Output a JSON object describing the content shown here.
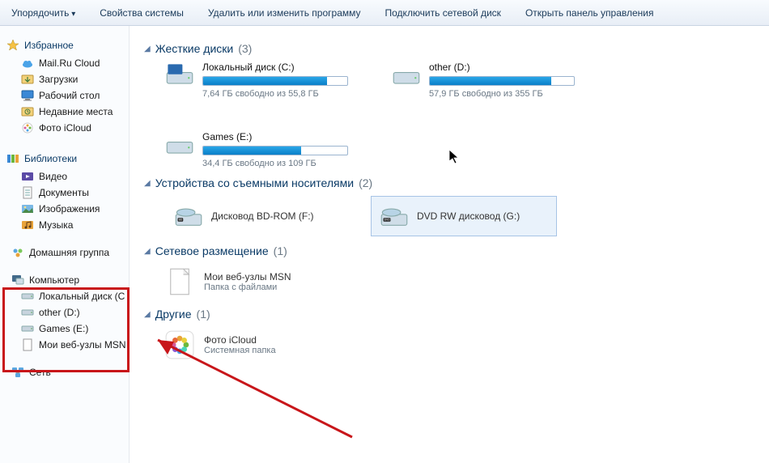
{
  "toolbar": {
    "organize": "Упорядочить",
    "system_props": "Свойства системы",
    "uninstall": "Удалить или изменить программу",
    "map_drive": "Подключить сетевой диск",
    "control_panel": "Открыть панель управления"
  },
  "sidebar": {
    "favorites": {
      "title": "Избранное",
      "items": [
        "Mail.Ru Cloud",
        "Загрузки",
        "Рабочий стол",
        "Недавние места",
        "Фото iCloud"
      ]
    },
    "libraries": {
      "title": "Библиотеки",
      "items": [
        "Видео",
        "Документы",
        "Изображения",
        "Музыка"
      ]
    },
    "homegroup": "Домашняя группа",
    "computer": {
      "title": "Компьютер",
      "items": [
        "Локальный диск (C",
        "other (D:)",
        "Games (E:)",
        "Мои веб-узлы MSN"
      ]
    },
    "network": "Сеть"
  },
  "sections": {
    "hdd": {
      "title": "Жесткие диски",
      "count": "(3)"
    },
    "removable": {
      "title": "Устройства со съемными носителями",
      "count": "(2)"
    },
    "network": {
      "title": "Сетевое размещение",
      "count": "(1)"
    },
    "other": {
      "title": "Другие",
      "count": "(1)"
    }
  },
  "drives": [
    {
      "name": "Локальный диск (C:)",
      "free": "7,64 ГБ свободно из 55,8 ГБ",
      "fill": 86
    },
    {
      "name": "other (D:)",
      "free": "57,9 ГБ свободно из 355 ГБ",
      "fill": 84
    },
    {
      "name": "Games (E:)",
      "free": "34,4 ГБ свободно из 109 ГБ",
      "fill": 68
    }
  ],
  "removable": [
    {
      "name": "Дисковод BD-ROM (F:)"
    },
    {
      "name": "DVD RW дисковод (G:)"
    }
  ],
  "netloc": {
    "name": "Мои веб-узлы MSN",
    "sub": "Папка с файлами"
  },
  "other": {
    "name": "Фото iCloud",
    "sub": "Системная папка"
  }
}
